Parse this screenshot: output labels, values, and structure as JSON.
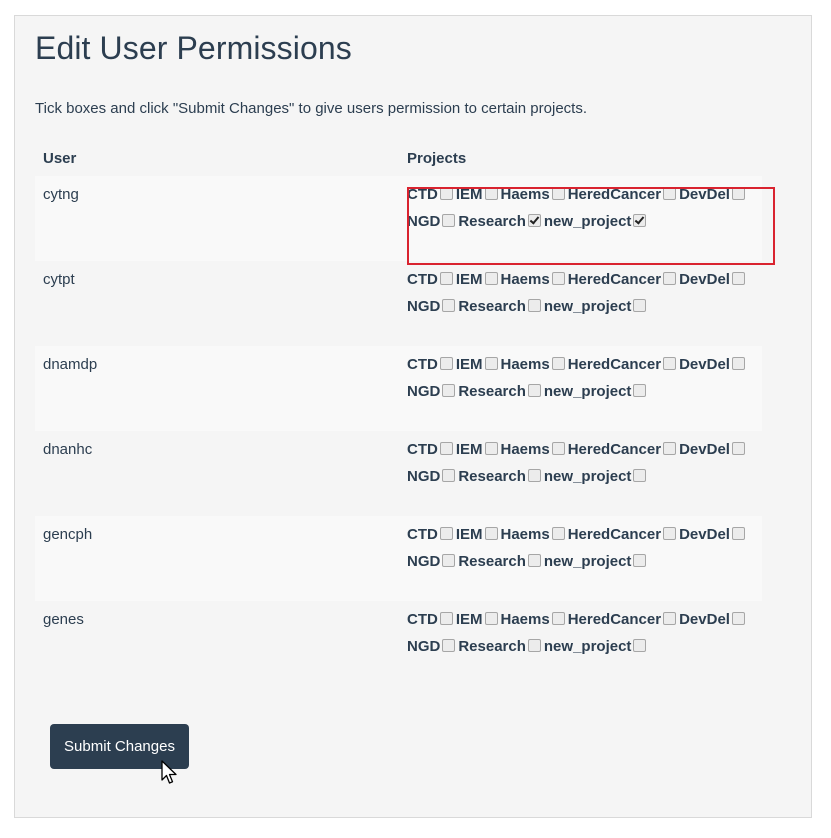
{
  "page": {
    "title": "Edit User Permissions",
    "intro": "Tick boxes and click \"Submit Changes\" to give users permission to certain projects."
  },
  "table": {
    "headers": {
      "user": "User",
      "projects": "Projects"
    },
    "project_lines": [
      [
        "CTD",
        "IEM",
        "Haems",
        "HeredCancer",
        "DevDel"
      ],
      [
        "NGD",
        "Research",
        "new_project"
      ]
    ],
    "rows": [
      {
        "user": "cytng",
        "checked": [
          "Research",
          "new_project"
        ],
        "highlighted": true
      },
      {
        "user": "cytpt",
        "checked": []
      },
      {
        "user": "dnamdp",
        "checked": []
      },
      {
        "user": "dnanhc",
        "checked": []
      },
      {
        "user": "gencph",
        "checked": []
      },
      {
        "user": "genes",
        "checked": []
      }
    ]
  },
  "submit": {
    "label": "Submit Changes"
  },
  "colors": {
    "primary": "#2c3e50",
    "highlight": "#d9232f",
    "panel": "#f5f5f5"
  }
}
